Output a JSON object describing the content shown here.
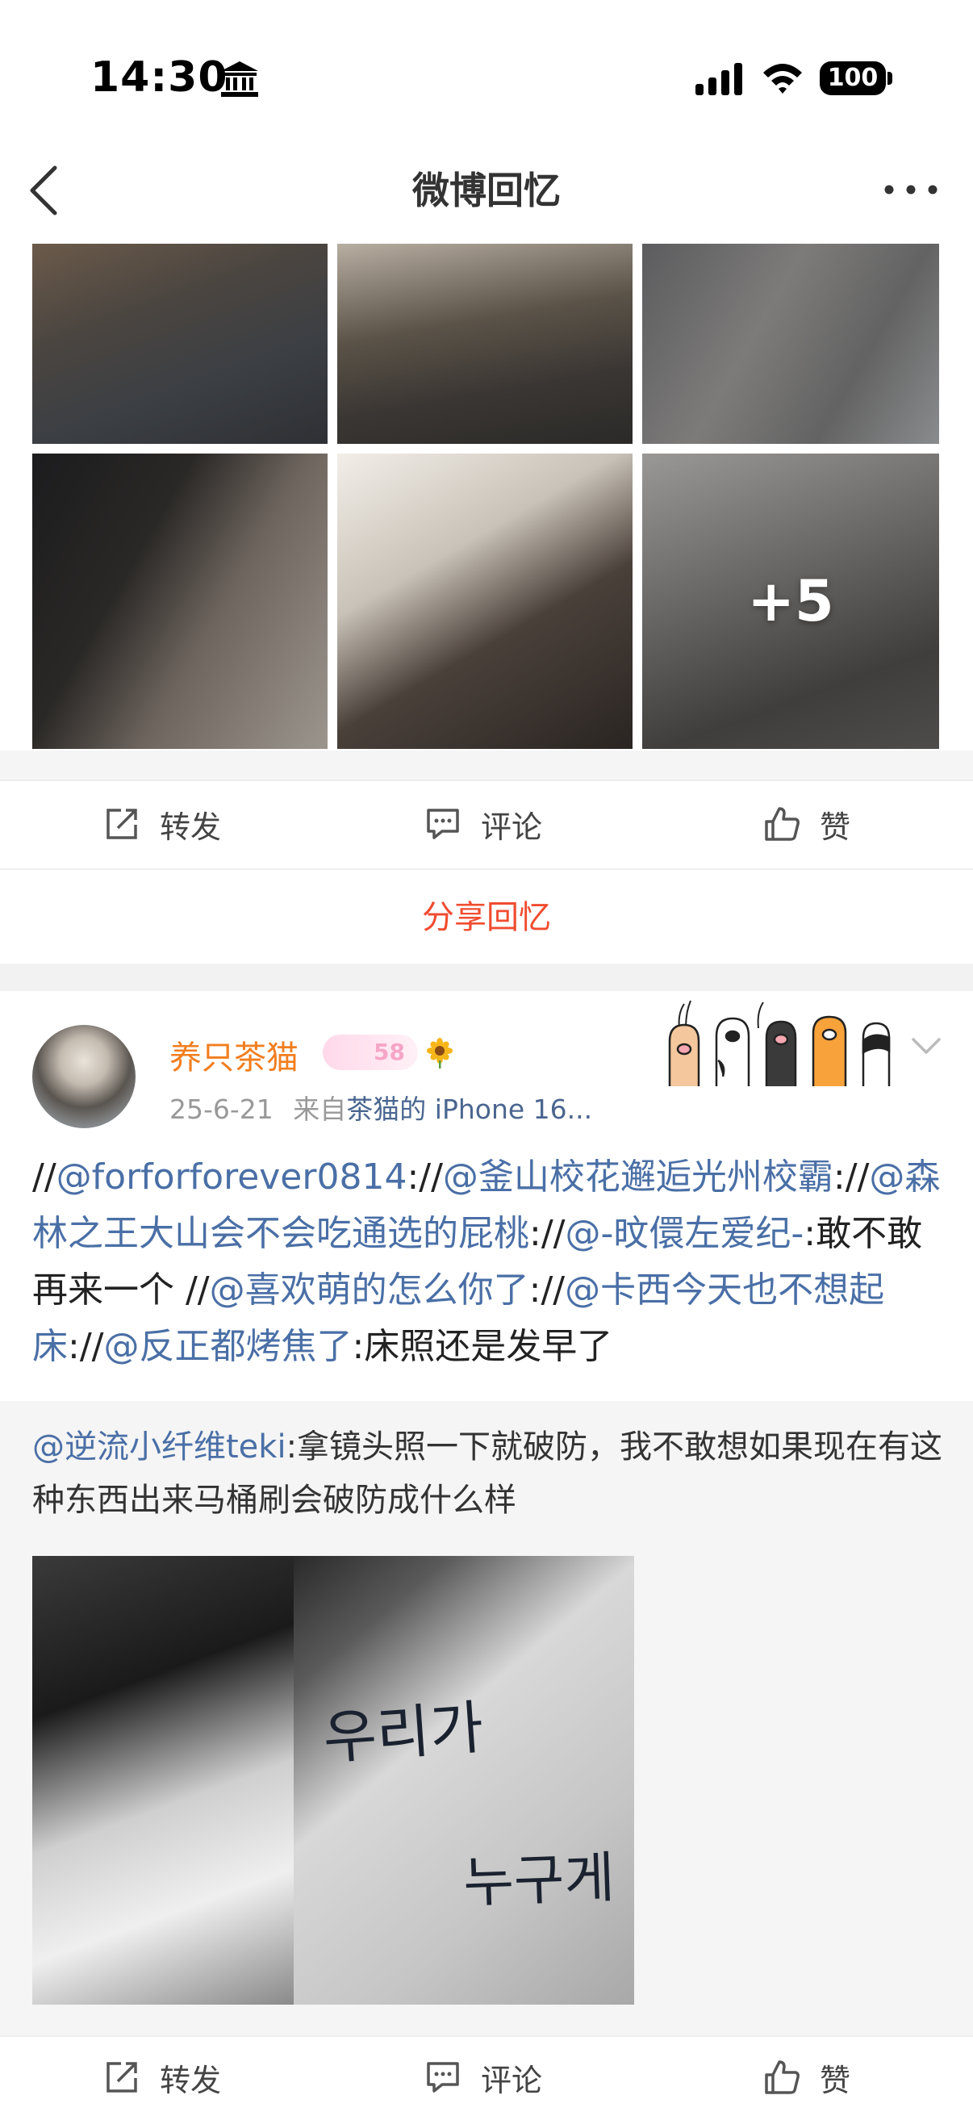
{
  "status_bar": {
    "time": "14:30",
    "battery": "100"
  },
  "nav": {
    "title": "微博回忆"
  },
  "photos": {
    "more_count": "+5"
  },
  "actions": {
    "repost": "转发",
    "comment": "评论",
    "like": "赞"
  },
  "share_memory": "分享回忆",
  "post": {
    "username": "养只茶猫",
    "level": "58",
    "date": "25-6-21",
    "source_prefix": "来自",
    "source": "茶猫的 iPhone 16...",
    "segments": [
      {
        "text": "//",
        "mention": false
      },
      {
        "text": "@forforforever0814",
        "mention": true
      },
      {
        "text": "://",
        "mention": false
      },
      {
        "text": "@釜山校花邂逅光州校霸",
        "mention": true
      },
      {
        "text": "://",
        "mention": false
      },
      {
        "text": "@森林之王大山会不会吃通选的屁桃",
        "mention": true
      },
      {
        "text": "://",
        "mention": false
      },
      {
        "text": "@-旼儇左爱纪-",
        "mention": true
      },
      {
        "text": ":敢不敢再来一个 //",
        "mention": false
      },
      {
        "text": "@喜欢萌的怎么你了",
        "mention": true
      },
      {
        "text": "://",
        "mention": false
      },
      {
        "text": "@卡西今天也不想起床",
        "mention": true
      },
      {
        "text": "://",
        "mention": false
      },
      {
        "text": "@反正都烤焦了",
        "mention": true
      },
      {
        "text": ":床照还是发早了",
        "mention": false
      }
    ],
    "quote": {
      "author": "@逆流小纤维teki",
      "text": ":拿镜头照一下就破防，我不敢想如果现在有这种东西出来马桶刷会破防成什么样",
      "handwriting_line1": "우리가",
      "handwriting_line2": "누구게"
    }
  },
  "colors": {
    "username": "#f27e1f",
    "mention": "#4a6fa6",
    "share": "#f04c30"
  }
}
